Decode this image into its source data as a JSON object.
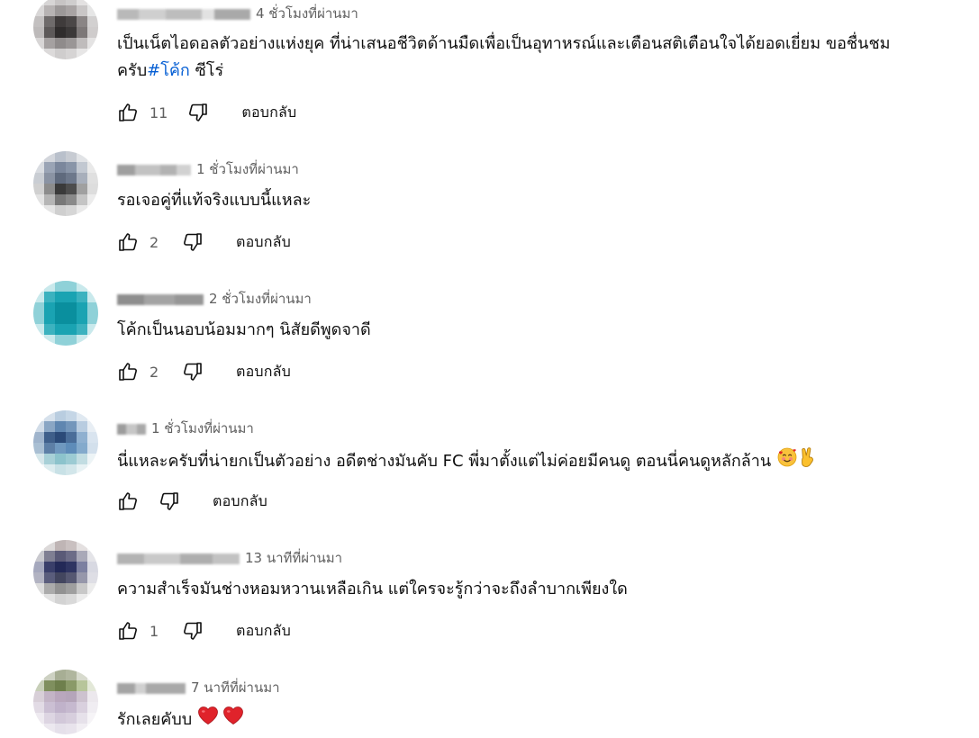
{
  "comments": [
    {
      "author": "mlnaeji2020 dfksnya",
      "time": "4 ชั่วโมงที่ผ่านมา",
      "text_before": "เป็นเน็ตไอดอลตัวอย่างแห่งยุค ที่น่าเสนอชีวิตด้านมืดเพื่อเป็นอุทาหรณ์และเตือนสติเตือนใจได้ยอดเยี่ยม  ขอชื่นชมครับ",
      "hashtag": "#โค้ก",
      "text_after": " ซีโร่",
      "likes": "11",
      "reply": "ตอบกลับ"
    },
    {
      "author": "Hunter Dr",
      "time": "1 ชั่วโมงที่ผ่านมา",
      "text_before": "รอเจอคู่ที่แท้จริงแบบนี้แหละ",
      "likes": "2",
      "reply": "ตอบกลับ"
    },
    {
      "author": "BLACKART",
      "time": "2 ชั่วโมงที่ผ่านมา",
      "text_before": "โค้กเป็นนอบน้อมมากๆ นิสัยดีพูดจาดี",
      "likes": "2",
      "reply": "ตอบกลับ"
    },
    {
      "author": "Lqt",
      "time": "1 ชั่วโมงที่ผ่านมา",
      "text_before": "นี่แหละครับที่น่ายกเป็นตัวอย่าง อดีตช่างมันคับ FC พี่มาตั้งแต่ไม่ค่อยมีคนดู ตอนนี่คนดูหลักล้าน ",
      "emojis": [
        "smiling-face-with-hearts-icon",
        "victory-hand-icon"
      ],
      "likes": "",
      "reply": "ตอบกลับ"
    },
    {
      "author": "Pop PakaDailym",
      "time": "13 นาทีที่ผ่านมา",
      "text_before": "ความสำเร็จมันช่างหอมหวานเหลือเกิน แต่ใครจะรู้กว่าจะถึงลำบากเพียงใด",
      "likes": "1",
      "reply": "ตอบกลับ"
    },
    {
      "author": "Kf dpnl",
      "time": "7 นาทีที่ผ่านมา",
      "text_before": "รักเลยคับบ ",
      "emojis": [
        "red-heart-icon",
        "red-heart-icon"
      ],
      "hide_actions": true
    }
  ],
  "colors": {
    "meta_text": "#606060",
    "body_text": "#0f0f0f",
    "hashtag": "#065fd4",
    "heart": "#e0232b"
  }
}
